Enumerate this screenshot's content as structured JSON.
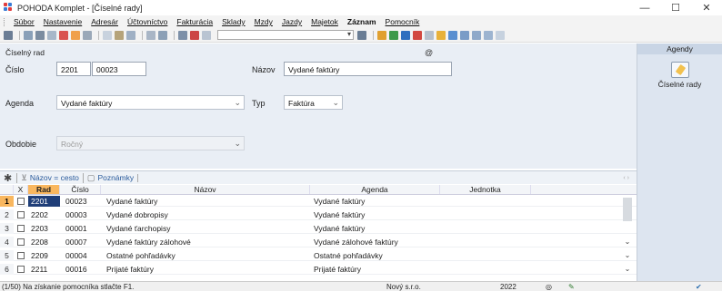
{
  "window": {
    "title": "POHODA Komplet - [Číselné rady]",
    "minimize": "—",
    "maximize": "☐",
    "close": "✕"
  },
  "menu": [
    {
      "label": "Súbor"
    },
    {
      "label": "Nastavenie"
    },
    {
      "label": "Adresár"
    },
    {
      "label": "Účtovníctvo"
    },
    {
      "label": "Fakturácia"
    },
    {
      "label": "Sklady"
    },
    {
      "label": "Mzdy"
    },
    {
      "label": "Jazdy"
    },
    {
      "label": "Majetok"
    },
    {
      "label": "Záznam",
      "bold": true
    },
    {
      "label": "Pomocník"
    }
  ],
  "form": {
    "group_title": "Číselný rad",
    "at_symbol": "@",
    "cislo_label": "Číslo",
    "cislo_rad": "2201",
    "cislo_number": "00023",
    "nazov_label": "Názov",
    "nazov_value": "Vydané faktúry",
    "agenda_label": "Agenda",
    "agenda_value": "Vydané faktúry",
    "typ_label": "Typ",
    "typ_value": "Faktúra",
    "obdobie_label": "Obdobie",
    "obdobie_value": "Ročný"
  },
  "agendy": {
    "header": "Agendy",
    "item_label": "Číselné rady",
    "item_icon": "numbering-icon"
  },
  "tabs": {
    "star": "✱",
    "filter_label": "Názov = cesto",
    "notes_label": "Poznámky",
    "nav": "‹ ›"
  },
  "table": {
    "columns": {
      "x": "X",
      "rad": "Rad",
      "cislo": "Číslo",
      "nazov": "Názov",
      "agenda": "Agenda",
      "jednotka": "Jednotka"
    },
    "rows": [
      {
        "n": "1",
        "rad": "2201",
        "cislo": "00023",
        "nazov": "Vydané faktúry",
        "agenda": "Vydané faktúry",
        "jednotka": ""
      },
      {
        "n": "2",
        "rad": "2202",
        "cislo": "00003",
        "nazov": "Vydané dobropisy",
        "agenda": "Vydané faktúry",
        "jednotka": ""
      },
      {
        "n": "3",
        "rad": "2203",
        "cislo": "00001",
        "nazov": "Vydané ťarchopisy",
        "agenda": "Vydané faktúry",
        "jednotka": ""
      },
      {
        "n": "4",
        "rad": "2208",
        "cislo": "00007",
        "nazov": "Vydané faktúry zálohové",
        "agenda": "Vydané zálohové faktúry",
        "jednotka": ""
      },
      {
        "n": "5",
        "rad": "2209",
        "cislo": "00004",
        "nazov": "Ostatné pohľadávky",
        "agenda": "Ostatné pohľadávky",
        "jednotka": ""
      },
      {
        "n": "6",
        "rad": "2211",
        "cislo": "00016",
        "nazov": "Prijaté faktúry",
        "agenda": "Prijaté faktúry",
        "jednotka": ""
      }
    ],
    "selected_row": 0
  },
  "status": {
    "hint": "(1/50) Na získanie pomocníka stlačte F1.",
    "company": "Nový s.r.o.",
    "year": "2022"
  },
  "colors": {
    "accent_orange": "#f9b75f",
    "selected_blue": "#1f3e78",
    "panel_bg": "#e9eef5"
  }
}
